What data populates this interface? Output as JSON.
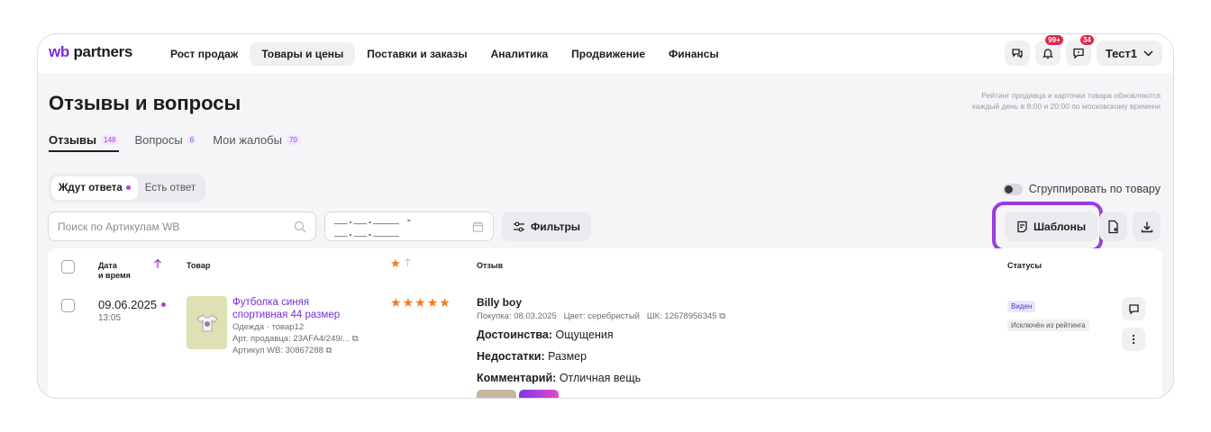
{
  "app": {
    "logo_wb": "wb",
    "logo_text": "partners"
  },
  "nav": {
    "items": [
      "Рост продаж",
      "Товары и цены",
      "Поставки и заказы",
      "Аналитика",
      "Продвижение",
      "Финансы"
    ],
    "active_index": 1,
    "notif_badge": "99+",
    "chat_badge": "34",
    "user_name": "Тест1"
  },
  "page": {
    "title": "Отзывы и вопросы",
    "rating_note_line1": "Рейтинг продавца и карточки товара обновляются",
    "rating_note_line2": "каждый день в 8:00 и 20:00 по московскому времени"
  },
  "tabs": [
    {
      "label": "Отзывы",
      "count": "148"
    },
    {
      "label": "Вопросы",
      "count": "6"
    },
    {
      "label": "Мои жалобы",
      "count": "70"
    }
  ],
  "status_switch": {
    "waiting": "Ждут ответа",
    "answered": "Есть ответ"
  },
  "group_toggle_label": "Сгруппировать по товару",
  "toolbar": {
    "search_placeholder": "Поиск по Артикулам WB",
    "date_range": "__.__.____ - __.__.____",
    "filters_label": "Фильтры",
    "templates_label": "Шаблоны"
  },
  "table": {
    "headers": {
      "date_line1": "Дата",
      "date_line2": "и время",
      "product": "Товар",
      "review": "Отзыв",
      "statuses": "Статусы"
    },
    "rows": [
      {
        "date": "09.06.2025",
        "time": "13:05",
        "product_name_line1": "Футболка синяя",
        "product_name_line2": "спортивная 44 размер",
        "category": "Одежда · товар12",
        "seller_article": "Арт. продавца: 23AFA4/249/...",
        "wb_article": "Артикул WB: 30867288",
        "rating": 5,
        "author": "Billy boy",
        "purchase_meta": "Покупка: 08.03.2025   Цвет: серебристый   ШК: 12678956345",
        "pros_label": "Достоинства:",
        "pros": "Ощущения",
        "cons_label": "Недостатки:",
        "cons": "Размер",
        "comment_label": "Комментарий:",
        "comment": "Отличная вещь",
        "status_visible": "Виден",
        "status_excluded": "Исключён из рейтинга"
      }
    ]
  },
  "colors": {
    "accent": "#9b3be0",
    "star": "#f27a21",
    "badge": "#e5254a"
  }
}
